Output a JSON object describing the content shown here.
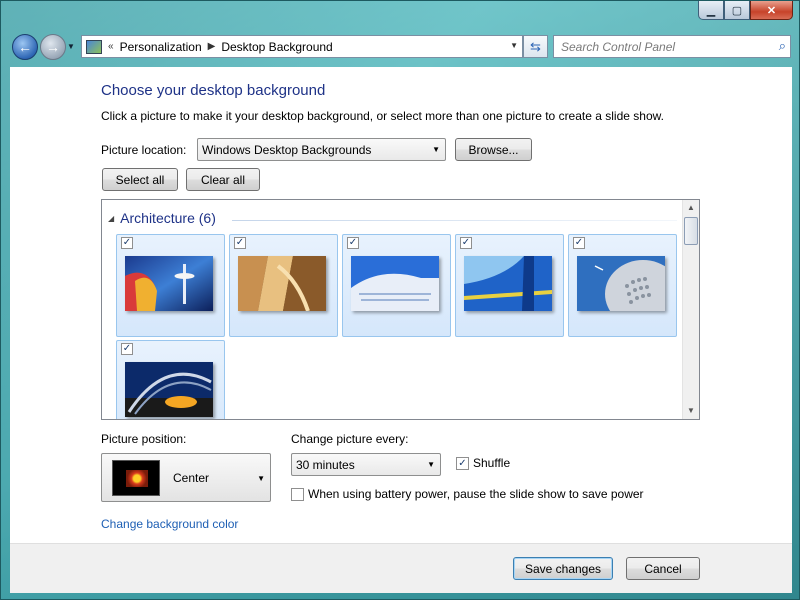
{
  "window": {
    "caption": {
      "minimize_icon": "minimize-icon",
      "maximize_icon": "maximize-icon",
      "close_icon": "close-icon"
    }
  },
  "nav": {
    "address_prefix": "«",
    "breadcrumb": [
      "Personalization",
      "Desktop Background"
    ],
    "search_placeholder": "Search Control Panel"
  },
  "page": {
    "title": "Choose your desktop background",
    "subtitle": "Click a picture to make it your desktop background, or select more than one picture to create a slide show.",
    "location_label": "Picture location:",
    "location_value": "Windows Desktop Backgrounds",
    "browse_label": "Browse...",
    "select_all_label": "Select all",
    "clear_all_label": "Clear all"
  },
  "gallery": {
    "group_title": "Architecture (6)",
    "tiles": [
      {
        "checked": true,
        "name": "architecture-1"
      },
      {
        "checked": true,
        "name": "architecture-2"
      },
      {
        "checked": true,
        "name": "architecture-3"
      },
      {
        "checked": true,
        "name": "architecture-4"
      },
      {
        "checked": true,
        "name": "architecture-5"
      },
      {
        "checked": true,
        "name": "architecture-6"
      }
    ]
  },
  "options": {
    "position_label": "Picture position:",
    "position_value": "Center",
    "interval_label": "Change picture every:",
    "interval_value": "30 minutes",
    "shuffle_label": "Shuffle",
    "shuffle_checked": true,
    "battery_label": "When using battery power, pause the slide show to save power",
    "battery_checked": false,
    "bg_color_link": "Change background color"
  },
  "footer": {
    "save_label": "Save changes",
    "cancel_label": "Cancel"
  },
  "colors": {
    "accent_title": "#1e3287",
    "link": "#1e5fb4",
    "selection": "#d5e7fb"
  }
}
